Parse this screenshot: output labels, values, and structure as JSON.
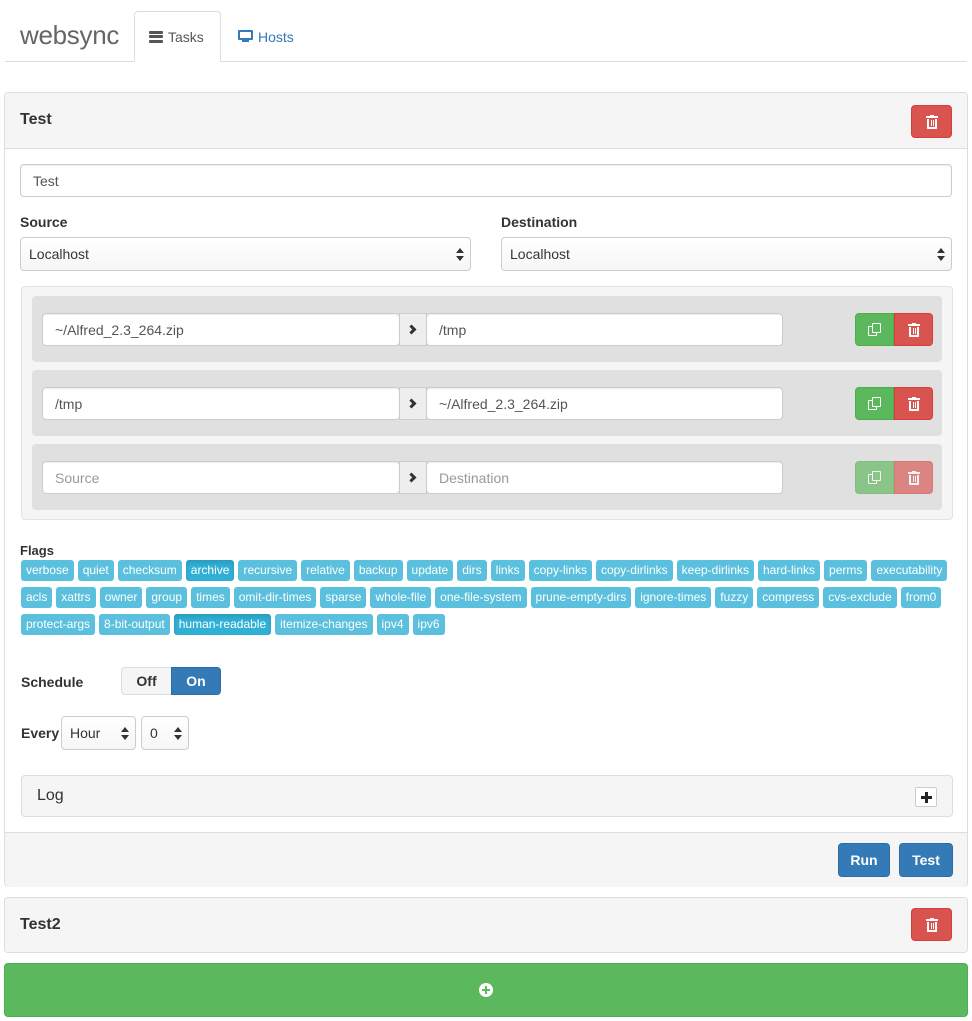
{
  "app": {
    "brand": "websync"
  },
  "nav": {
    "tasks_label": "Tasks",
    "hosts_label": "Hosts"
  },
  "task1": {
    "title": "Test",
    "name_value": "Test",
    "source_label": "Source",
    "source_value": "Localhost",
    "destination_label": "Destination",
    "destination_value": "Localhost",
    "paths": [
      {
        "source": "~/Alfred_2.3_264.zip",
        "destination": "/tmp"
      },
      {
        "source": "/tmp",
        "destination": "~/Alfred_2.3_264.zip"
      },
      {
        "source_placeholder": "Source",
        "destination_placeholder": "Destination"
      }
    ],
    "flags_label": "Flags",
    "flags": [
      {
        "label": "verbose",
        "active": false
      },
      {
        "label": "quiet",
        "active": false
      },
      {
        "label": "checksum",
        "active": false
      },
      {
        "label": "archive",
        "active": true
      },
      {
        "label": "recursive",
        "active": false
      },
      {
        "label": "relative",
        "active": false
      },
      {
        "label": "backup",
        "active": false
      },
      {
        "label": "update",
        "active": false
      },
      {
        "label": "dirs",
        "active": false
      },
      {
        "label": "links",
        "active": false
      },
      {
        "label": "copy-links",
        "active": false
      },
      {
        "label": "copy-dirlinks",
        "active": false
      },
      {
        "label": "keep-dirlinks",
        "active": false
      },
      {
        "label": "hard-links",
        "active": false
      },
      {
        "label": "perms",
        "active": false
      },
      {
        "label": "executability",
        "active": false
      },
      {
        "label": "acls",
        "active": false
      },
      {
        "label": "xattrs",
        "active": false
      },
      {
        "label": "owner",
        "active": false
      },
      {
        "label": "group",
        "active": false
      },
      {
        "label": "times",
        "active": false
      },
      {
        "label": "omit-dir-times",
        "active": false
      },
      {
        "label": "sparse",
        "active": false
      },
      {
        "label": "whole-file",
        "active": false
      },
      {
        "label": "one-file-system",
        "active": false
      },
      {
        "label": "prune-empty-dirs",
        "active": false
      },
      {
        "label": "ignore-times",
        "active": false
      },
      {
        "label": "fuzzy",
        "active": false
      },
      {
        "label": "compress",
        "active": false
      },
      {
        "label": "cvs-exclude",
        "active": false
      },
      {
        "label": "from0",
        "active": false
      },
      {
        "label": "protect-args",
        "active": false
      },
      {
        "label": "8-bit-output",
        "active": false
      },
      {
        "label": "human-readable",
        "active": true
      },
      {
        "label": "itemize-changes",
        "active": false
      },
      {
        "label": "ipv4",
        "active": false
      },
      {
        "label": "ipv6",
        "active": false
      }
    ],
    "schedule_label": "Schedule",
    "schedule_off": "Off",
    "schedule_on": "On",
    "every_label": "Every",
    "every_unit": "Hour",
    "every_value": "0",
    "log_label": "Log",
    "run_label": "Run",
    "test_label": "Test"
  },
  "task2": {
    "title": "Test2"
  },
  "colors": {
    "primary": "#337ab7",
    "success": "#5cb85c",
    "danger": "#d9534f",
    "info": "#5bc0de"
  }
}
